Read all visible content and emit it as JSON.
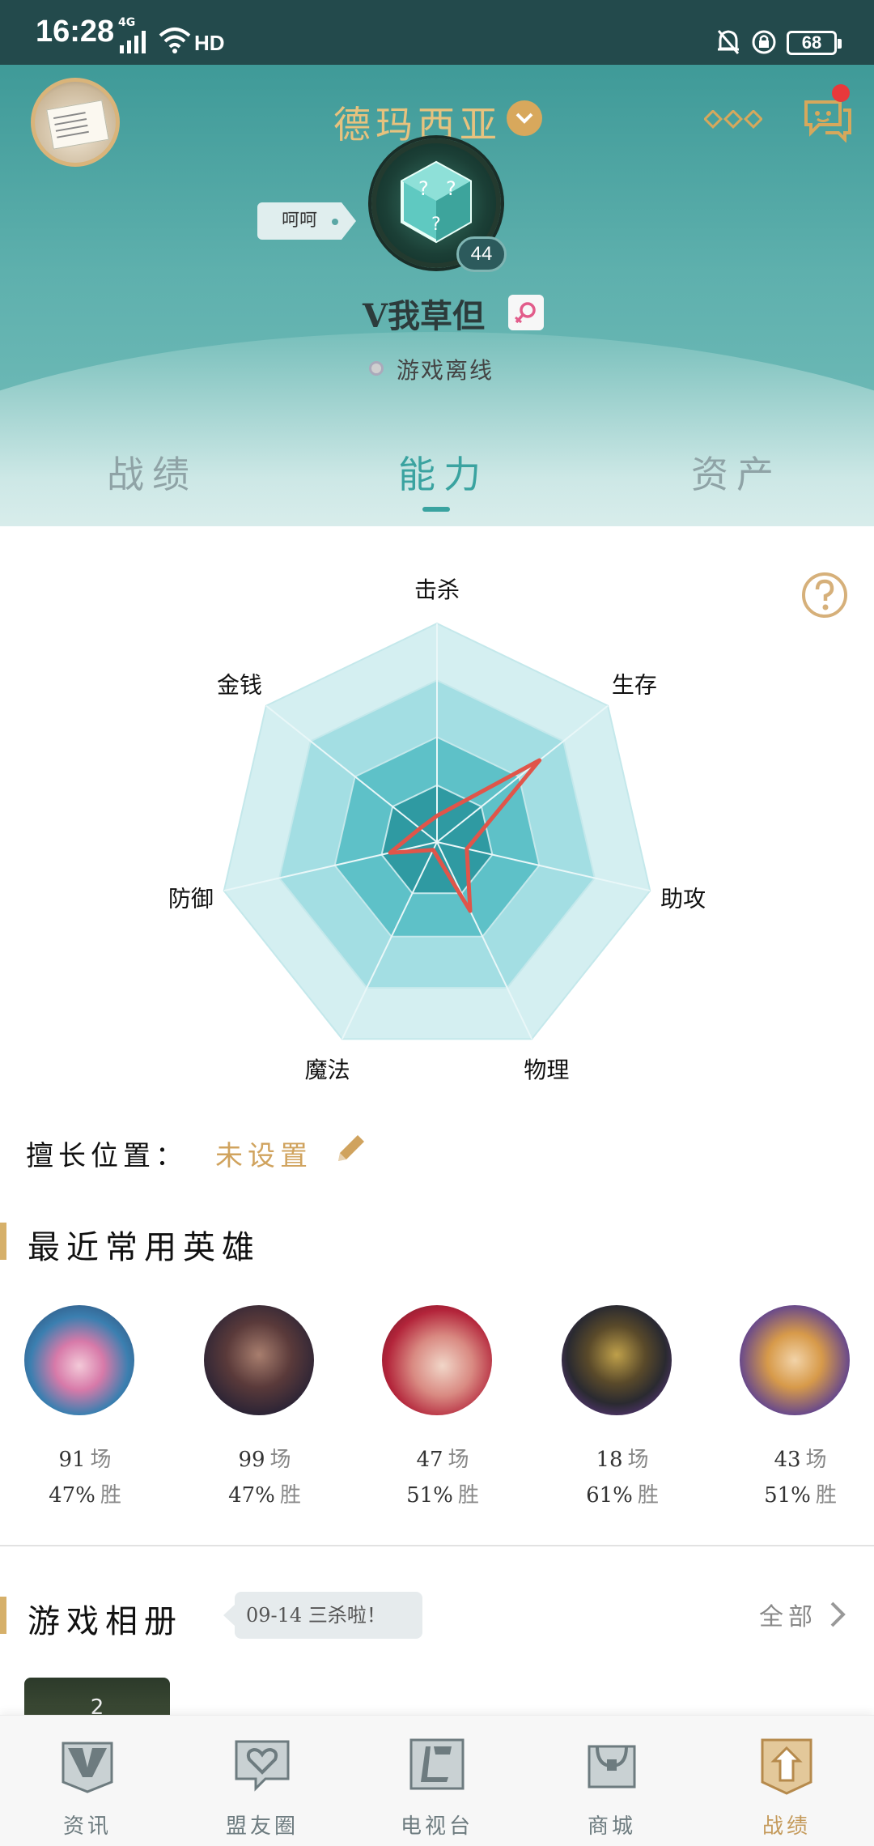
{
  "status_bar": {
    "time": "16:28",
    "network": "4G",
    "hd": "HD",
    "battery": "68"
  },
  "header": {
    "server": "德玛西亚",
    "tag": "呵呵",
    "level": "44",
    "nickname": "V我草但",
    "online_status": "游戏离线"
  },
  "tabs": [
    {
      "label": "战绩",
      "active": false
    },
    {
      "label": "能力",
      "active": true
    },
    {
      "label": "资产",
      "active": false
    }
  ],
  "chart_data": {
    "type": "radar",
    "axes": [
      "击杀",
      "生存",
      "助攻",
      "物理",
      "魔法",
      "防御",
      "金钱"
    ],
    "range": [
      0,
      100
    ],
    "values": [
      12,
      60,
      14,
      35,
      4,
      22,
      10
    ],
    "series_color": "#e0554a"
  },
  "position": {
    "label": "擅长位置：",
    "value": "未设置"
  },
  "recent_heroes": {
    "title": "最近常用英雄",
    "unit_games": "场",
    "unit_wins": "胜",
    "items": [
      {
        "games": "91",
        "win_rate": "47%"
      },
      {
        "games": "99",
        "win_rate": "47%"
      },
      {
        "games": "47",
        "win_rate": "51%"
      },
      {
        "games": "18",
        "win_rate": "61%"
      },
      {
        "games": "43",
        "win_rate": "51%"
      }
    ]
  },
  "album": {
    "title": "游戏相册",
    "tip": "09-14 三杀啦！",
    "all_label": "全部",
    "thumb_count": "2"
  },
  "bottom_nav": [
    {
      "label": "资讯",
      "icon": "news-icon",
      "active": false
    },
    {
      "label": "盟友圈",
      "icon": "community-icon",
      "active": false
    },
    {
      "label": "电视台",
      "icon": "tv-icon",
      "active": false
    },
    {
      "label": "商城",
      "icon": "shop-icon",
      "active": false
    },
    {
      "label": "战绩",
      "icon": "record-icon",
      "active": true
    }
  ],
  "colors": {
    "accent": "#3aa3a0",
    "gold": "#d0a35e",
    "status_bar": "#234a4c"
  }
}
